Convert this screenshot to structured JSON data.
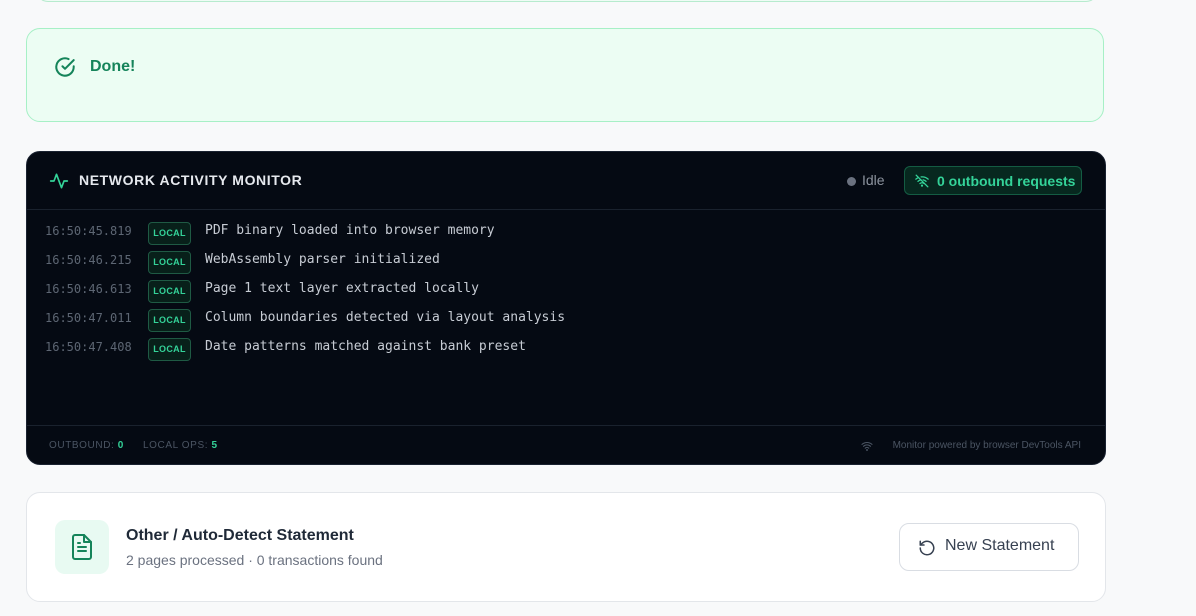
{
  "status": {
    "text": "Done!"
  },
  "monitor": {
    "title": "NETWORK ACTIVITY MONITOR",
    "state": "Idle",
    "outbound_pill": "0 outbound requests",
    "log": [
      {
        "time": "16:50:45.819",
        "badge": "LOCAL",
        "message": "PDF binary loaded into browser memory"
      },
      {
        "time": "16:50:46.215",
        "badge": "LOCAL",
        "message": "WebAssembly parser initialized"
      },
      {
        "time": "16:50:46.613",
        "badge": "LOCAL",
        "message": "Page 1 text layer extracted locally"
      },
      {
        "time": "16:50:47.011",
        "badge": "LOCAL",
        "message": "Column boundaries detected via layout analysis"
      },
      {
        "time": "16:50:47.408",
        "badge": "LOCAL",
        "message": "Date patterns matched against bank preset"
      }
    ],
    "footer": {
      "outbound_label": "OUTBOUND:",
      "outbound_value": "0",
      "local_ops_label": "LOCAL OPS:",
      "local_ops_value": "5",
      "powered_by": "Monitor powered by browser DevTools API"
    }
  },
  "statement": {
    "title": "Other / Auto-Detect Statement",
    "subtitle": "2 pages processed · 0 transactions found",
    "new_button": "New Statement"
  },
  "colors": {
    "accent": "#34d399",
    "success_text": "#15845a",
    "monitor_bg": "#050a13"
  },
  "icons": [
    "check-circle-icon",
    "activity-pulse-icon",
    "wifi-off-icon",
    "wifi-icon",
    "document-icon",
    "refresh-icon"
  ]
}
